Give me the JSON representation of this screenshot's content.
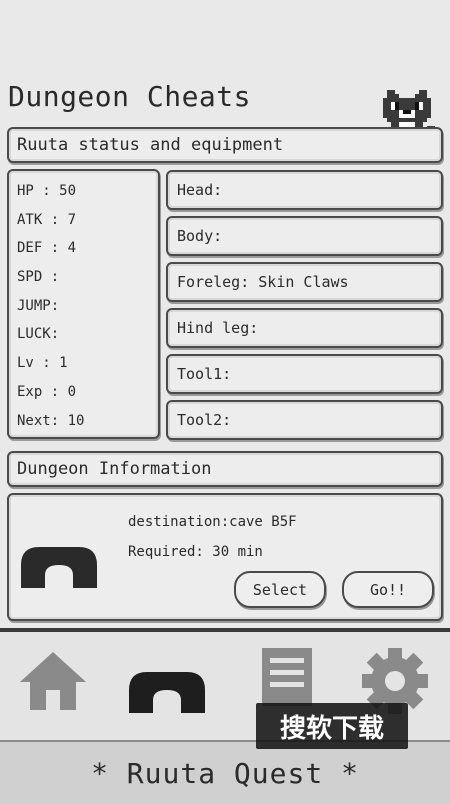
{
  "page_title": "Dungeon Cheats",
  "status_header": "Ruuta status and equipment",
  "stats": [
    {
      "label": "HP",
      "value": "HP  : 50"
    },
    {
      "label": "ATK",
      "value": "ATK : 7"
    },
    {
      "label": "DEF",
      "value": "DEF : 4"
    },
    {
      "label": "SPD",
      "value": "SPD :"
    },
    {
      "label": "JUMP",
      "value": "JUMP:"
    },
    {
      "label": "LUCK",
      "value": "LUCK:"
    },
    {
      "label": "Lv",
      "value": "Lv  : 1"
    },
    {
      "label": "Exp",
      "value": "Exp : 0"
    },
    {
      "label": "Next",
      "value": "Next: 10"
    }
  ],
  "equipment": [
    {
      "slot": "Head",
      "text": "Head:"
    },
    {
      "slot": "Body",
      "text": "Body:"
    },
    {
      "slot": "Foreleg",
      "text": "Foreleg: Skin Claws"
    },
    {
      "slot": "Hind leg",
      "text": "Hind leg:"
    },
    {
      "slot": "Tool1",
      "text": "Tool1:"
    },
    {
      "slot": "Tool2",
      "text": "Tool2:"
    }
  ],
  "dungeon_header": "Dungeon Information",
  "dungeon": {
    "destination": "destination:cave B5F",
    "required": "Required: 30 min",
    "select_label": "Select",
    "go_label": "Go!!"
  },
  "nav": {
    "items": [
      {
        "icon": "home-icon"
      },
      {
        "icon": "cave-icon",
        "active": true
      },
      {
        "icon": "document-icon"
      },
      {
        "icon": "gear-icon"
      }
    ]
  },
  "footer_title": "* Ruuta Quest *",
  "watermark": "搜软下载",
  "colors": {
    "background": "#e9e9e9",
    "border": "#4a4a4a",
    "icon_inactive": "#8a8a8a",
    "icon_active": "#1e1e1e",
    "footer": "#d0d0d0"
  }
}
